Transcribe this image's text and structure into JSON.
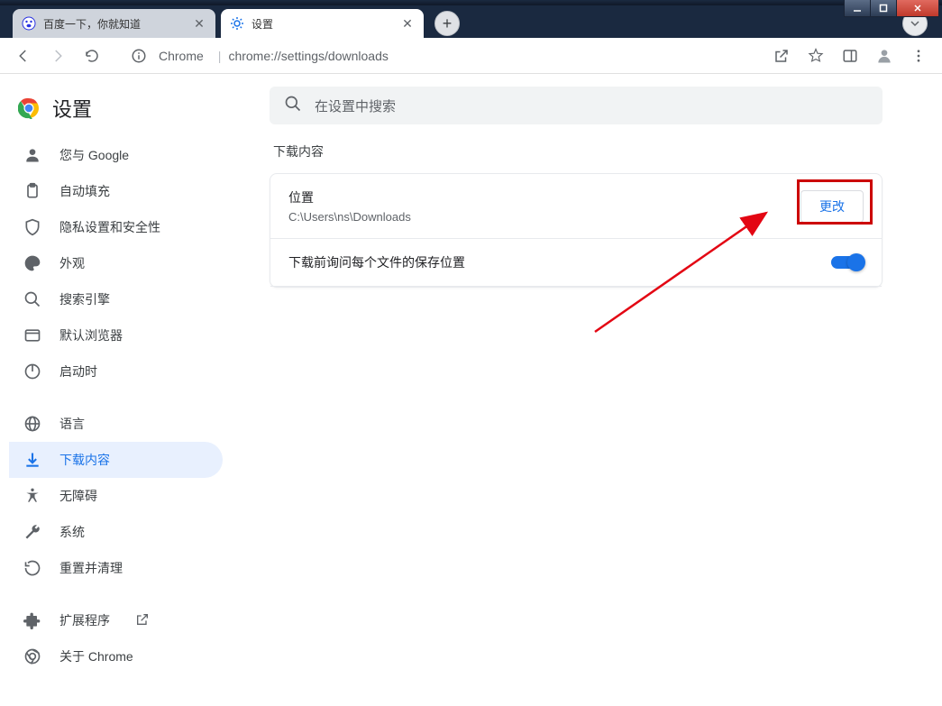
{
  "window": {
    "tabs": [
      {
        "title": "百度一下，你就知道",
        "favicon": "baidu"
      },
      {
        "title": "设置",
        "favicon": "gear"
      }
    ]
  },
  "toolbar": {
    "chrome_label": "Chrome",
    "url_path": "chrome://settings/downloads"
  },
  "sidebar": {
    "title": "设置",
    "items": [
      {
        "label": "您与 Google",
        "icon": "person"
      },
      {
        "label": "自动填充",
        "icon": "clipboard"
      },
      {
        "label": "隐私设置和安全性",
        "icon": "shield"
      },
      {
        "label": "外观",
        "icon": "palette"
      },
      {
        "label": "搜索引擎",
        "icon": "search"
      },
      {
        "label": "默认浏览器",
        "icon": "browser"
      },
      {
        "label": "启动时",
        "icon": "power"
      }
    ],
    "items2": [
      {
        "label": "语言",
        "icon": "globe"
      },
      {
        "label": "下载内容",
        "icon": "download",
        "active": true
      },
      {
        "label": "无障碍",
        "icon": "accessibility"
      },
      {
        "label": "系统",
        "icon": "wrench"
      },
      {
        "label": "重置并清理",
        "icon": "restore"
      }
    ],
    "items3": [
      {
        "label": "扩展程序",
        "icon": "extension",
        "external": true
      },
      {
        "label": "关于 Chrome",
        "icon": "chrome"
      }
    ]
  },
  "main": {
    "search_placeholder": "在设置中搜索",
    "section_title": "下载内容",
    "location_label": "位置",
    "location_value": "C:\\Users\\ns\\Downloads",
    "change_button": "更改",
    "ask_before_label": "下载前询问每个文件的保存位置"
  }
}
